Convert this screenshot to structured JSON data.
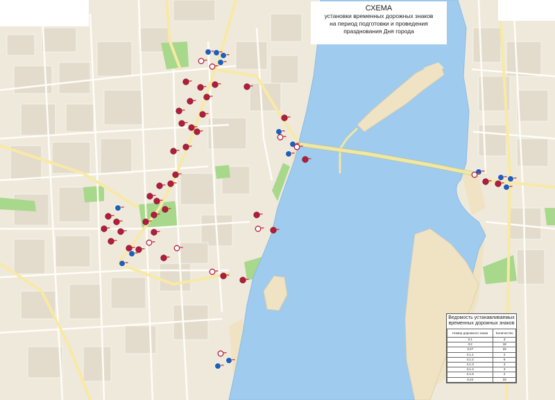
{
  "title": {
    "line1": "СХЕМА",
    "line2": "установки временных дорожных знаков",
    "line3": "на период подготовки и проведения",
    "line4": "празднования Дня города"
  },
  "legend": {
    "title_line1": "Ведомость устанавливаемых",
    "title_line2": "временных дорожных знаков",
    "col1": "Номер дорожного знака",
    "col2": "Количество",
    "rows": [
      {
        "sign": "3.1",
        "count": "3"
      },
      {
        "sign": "3.2",
        "count": "18"
      },
      {
        "sign": "3.27",
        "count": "33"
      },
      {
        "sign": "4.1.1",
        "count": "2"
      },
      {
        "sign": "4.1.2",
        "count": "6"
      },
      {
        "sign": "4.1.3",
        "count": "3"
      },
      {
        "sign": "4.1.4",
        "count": "3"
      },
      {
        "sign": "4.1.6",
        "count": "2"
      },
      {
        "sign": "6.24",
        "count": "33"
      }
    ]
  },
  "colors": {
    "background": "#efe9dc",
    "water": "#9fcbee",
    "water_edge": "#8bbbe3",
    "street": "#fffdf8",
    "arterial": "#f8e9a4",
    "park": "#a8d88b",
    "sand": "#efe3c4",
    "bridge": "#f0e7a2",
    "sign_red": "#b51c3c",
    "sign_blue": "#1f5fb7"
  },
  "icons": {
    "no_stopping_sign": "red-disc-sign",
    "no_entry_sign": "red-ring-sign",
    "direction_sign": "blue-arrow-sign"
  }
}
